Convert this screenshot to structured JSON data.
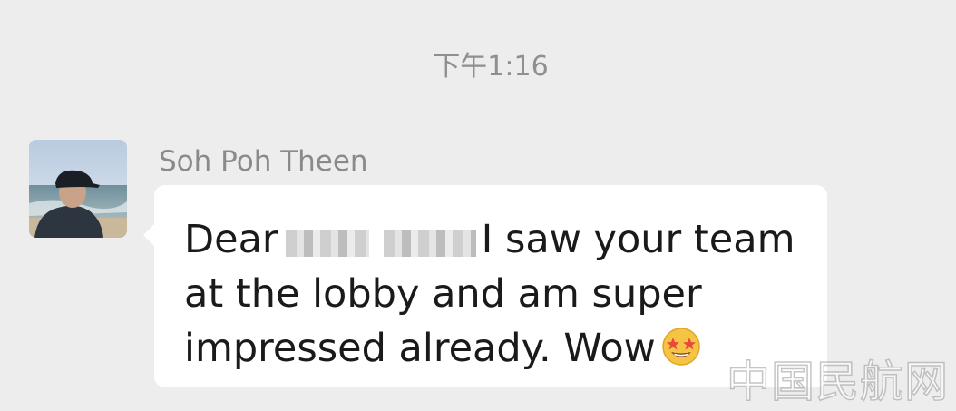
{
  "chat": {
    "timestamp": "下午1:16",
    "message": {
      "sender_name": "Soh Poh Theen",
      "text_before_redaction": "Dear",
      "text_after_redaction": "I saw your team at the lobby and am super impressed already.  Wow",
      "emoji": "star-struck-emoji"
    }
  },
  "watermark": {
    "text": "中国民航网"
  },
  "colors": {
    "background": "#ededed",
    "bubble": "#ffffff",
    "text": "#1a1a1a",
    "meta_text": "#8f8f8f"
  }
}
